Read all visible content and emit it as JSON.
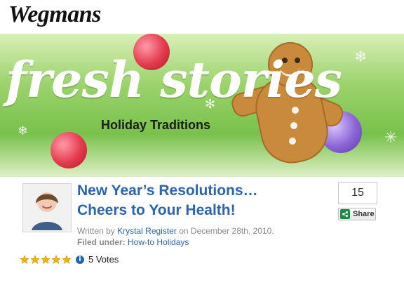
{
  "brand": {
    "name": "Wegmans"
  },
  "banner": {
    "title": "fresh stories",
    "subtitle": "Holiday Traditions"
  },
  "post": {
    "title_line1": "New Year’s Resolutions…",
    "title_line2": "Cheers to Your Health!",
    "written_by_prefix": "Written by",
    "author": "Krystal Register",
    "date_text": "on December 28th, 2010.",
    "filed_under_label": "Filed under:",
    "category": "How-to Holidays"
  },
  "share": {
    "count": "15",
    "label": "Share"
  },
  "rating": {
    "stars": 5,
    "votes_text": "5 Votes"
  },
  "colors": {
    "link_blue": "#2a65ad",
    "star_gold": "#f4b400",
    "share_green": "#1c8b45"
  }
}
